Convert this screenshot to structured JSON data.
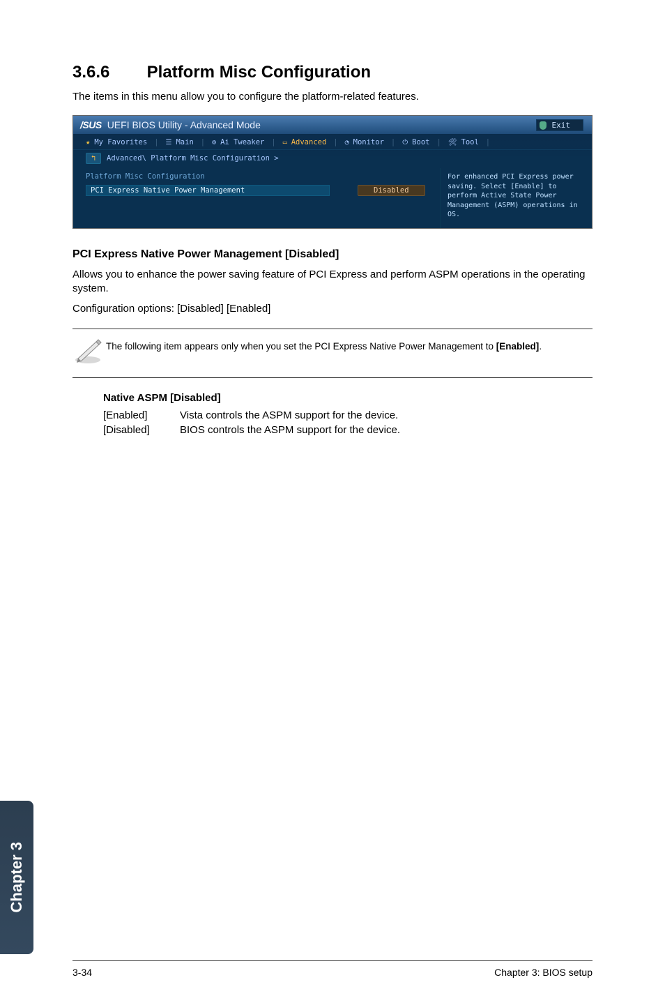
{
  "section": {
    "number": "3.6.6",
    "title": "Platform Misc Configuration",
    "intro": "The items in this menu allow you to configure the platform-related features."
  },
  "bios": {
    "logo": "/SUS",
    "mode": "UEFI BIOS Utility - Advanced Mode",
    "exit": "Exit",
    "tabs": {
      "favorites": "My Favorites",
      "main": "Main",
      "tweaker": "Ai Tweaker",
      "advanced": "Advanced",
      "monitor": "Monitor",
      "boot": "Boot",
      "tool": "Tool"
    },
    "breadcrumb": "Advanced\\ Platform Misc Configuration >",
    "back_glyph": "↰",
    "section_label": "Platform Misc Configuration",
    "setting_label": "PCI Express Native Power Management",
    "setting_value": "Disabled",
    "help_text": "For enhanced PCI Express power saving. Select [Enable] to perform Active State Power Management (ASPM) operations in OS."
  },
  "subheading": "PCI Express Native Power Management [Disabled]",
  "para1": "Allows you to enhance the power saving feature of PCI Express and perform ASPM operations in the operating system.",
  "para2": "Configuration options: [Disabled] [Enabled]",
  "note": {
    "text_pre": "The following item appears only when you set the PCI Express Native Power Management to ",
    "bold": "[Enabled]",
    "text_post": "."
  },
  "option": {
    "title": "Native ASPM [Disabled]",
    "rows": [
      {
        "key": "[Enabled]",
        "desc": "Vista controls the ASPM support for the device."
      },
      {
        "key": "[Disabled]",
        "desc": "BIOS controls the ASPM support for the device."
      }
    ]
  },
  "side_tab": "Chapter 3",
  "footer": {
    "left": "3-34",
    "right": "Chapter 3: BIOS setup"
  }
}
